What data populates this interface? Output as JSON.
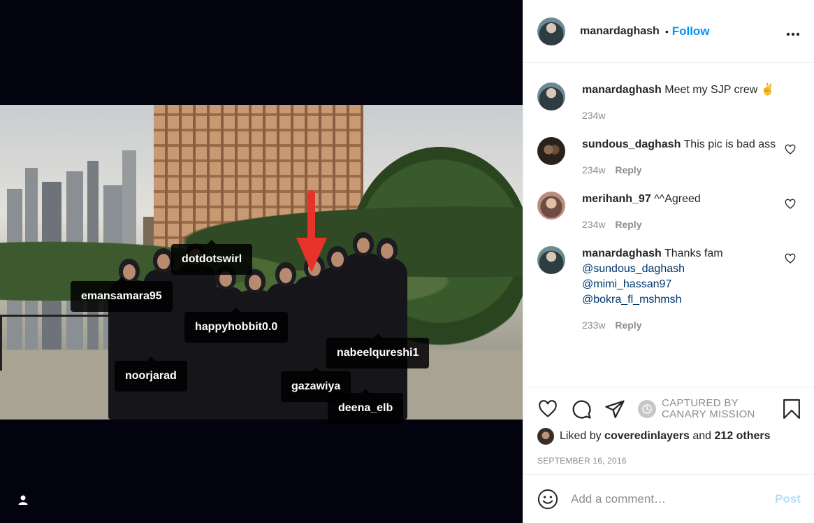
{
  "post": {
    "author": "manardaghash",
    "follow_label": "Follow",
    "separator": "•",
    "more_icon": "more-horizontal-icon"
  },
  "photo": {
    "tags": [
      "dotdotswirl",
      "emansamara95",
      "happyhobbit0.0",
      "nabeelqureshi1",
      "noorjarad",
      "gazawiya",
      "deena_elb"
    ],
    "annotation_color": "#e8332b"
  },
  "caption": {
    "username": "manardaghash",
    "text": "Meet my SJP crew ✌",
    "age": "234w"
  },
  "comments": [
    {
      "username": "sundous_daghash",
      "text": "This pic is bad ass",
      "age": "234w",
      "reply_label": "Reply"
    },
    {
      "username": "merihanh_97",
      "text": "^^Agreed",
      "age": "234w",
      "reply_label": "Reply"
    },
    {
      "username": "manardaghash",
      "text": "Thanks fam",
      "mentions": [
        "@sundous_daghash",
        "@mimi_hassan97",
        "@bokra_fl_mshmsh"
      ],
      "age": "233w",
      "reply_label": "Reply"
    }
  ],
  "watermark": {
    "line1": "CAPTURED BY",
    "line2": "CANARY MISSION"
  },
  "likes": {
    "prefix": "Liked by",
    "user": "coveredinlayers",
    "middle": "and",
    "others": "212 others"
  },
  "date": "SEPTEMBER 16, 2016",
  "add_comment": {
    "placeholder": "Add a comment…",
    "post_label": "Post"
  },
  "colors": {
    "link": "#0095f6",
    "mention": "#00376b",
    "muted": "#8e8e8e",
    "post_disabled": "#b2dffc"
  }
}
